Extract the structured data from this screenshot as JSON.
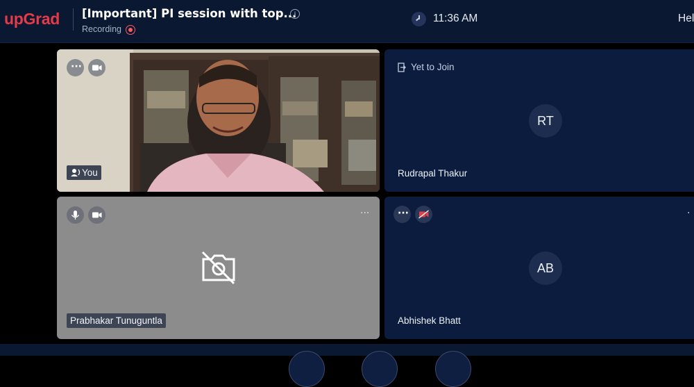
{
  "header": {
    "logo_text": "upGrad",
    "title": "[Important] PI session with top...",
    "recording_label": "Recording",
    "time": "11:36 AM",
    "help_label": "Help"
  },
  "participants": [
    {
      "name_label": "You"
    },
    {
      "status": "Yet to Join",
      "initials": "RT",
      "name": "Rudrapal Thakur"
    },
    {
      "name": "Prabhakar Tunuguntla"
    },
    {
      "initials": "AB",
      "name": "Abhishek Bhatt"
    }
  ],
  "colors": {
    "brand": "#e53b48",
    "header_bg": "#0b1832",
    "tile_dark": "#0b1c3e",
    "tile_gray": "#8c8c8c",
    "record": "#ff5a63",
    "camera_off_red": "#e0404a"
  },
  "icons": [
    "info-icon",
    "record-icon",
    "clock-icon",
    "more-icon",
    "camera-icon",
    "speaker-icon",
    "exit-icon",
    "microphone-icon",
    "camera-off-icon"
  ]
}
